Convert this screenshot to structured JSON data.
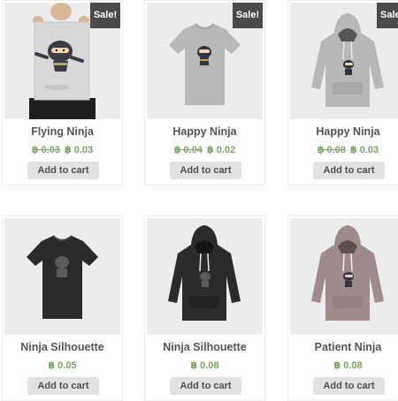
{
  "products": [
    {
      "name": "Flying Ninja",
      "sale_badge": "Sale!",
      "old_price": "฿ 0.03",
      "price": "฿ 0.03",
      "button": "Add to cart",
      "image": "poster-icon"
    },
    {
      "name": "Happy Ninja",
      "sale_badge": "Sale!",
      "old_price": "฿ 0.04",
      "price": "฿ 0.02",
      "button": "Add to cart",
      "image": "tshirt-icon"
    },
    {
      "name": "Happy Ninja",
      "sale_badge": "Sale",
      "old_price": "฿ 0.08",
      "price": "฿ 0.03",
      "button": "Add to cart",
      "image": "hoodie-icon"
    },
    {
      "name": "Ninja Silhouette",
      "price": "฿ 0.05",
      "button": "Add to cart",
      "image": "tshirt-icon"
    },
    {
      "name": "Ninja Silhouette",
      "price": "฿ 0.08",
      "button": "Add to cart",
      "image": "hoodie-icon"
    },
    {
      "name": "Patient Ninja",
      "price": "฿ 0.08",
      "button": "Add to cart",
      "image": "hoodie-icon"
    }
  ],
  "colors": {
    "price_green": "#77a464",
    "badge_bg": "#4a4a4a",
    "button_bg": "#e2e2e2",
    "tile_bg": "#ebebeb",
    "shirt_grey": "#b5b5b5",
    "hoodie_grey": "#b8b8b8",
    "shirt_black": "#2a2a2a",
    "hoodie_black": "#2b2b2b",
    "hoodie_mauve": "#a08a8c"
  }
}
